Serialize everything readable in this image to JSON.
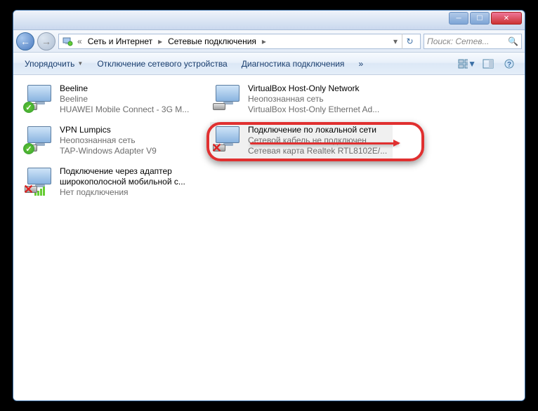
{
  "breadcrumb": {
    "part1": "Сеть и Интернет",
    "part2": "Сетевые подключения"
  },
  "search": {
    "placeholder": "Поиск: Сетев..."
  },
  "toolbar": {
    "organize": "Упорядочить",
    "disable": "Отключение сетевого устройства",
    "diagnose": "Диагностика подключения",
    "more": "»"
  },
  "connections": {
    "left": [
      {
        "name": "Beeline",
        "status": "Beeline",
        "device": "HUAWEI Mobile Connect - 3G M...",
        "badge": "check"
      },
      {
        "name": "VPN Lumpics",
        "status": "Неопознанная сеть",
        "device": "TAP-Windows Adapter V9",
        "badge": "check"
      },
      {
        "name": "Подключение через адаптер широкополосной мобильной с...",
        "status": "Нет подключения",
        "device": "",
        "badge": "bars-x"
      }
    ],
    "right": [
      {
        "name": "VirtualBox Host-Only Network",
        "status": "Неопознанная сеть",
        "device": "VirtualBox Host-Only Ethernet Ad...",
        "badge": "none"
      },
      {
        "name": "Подключение по локальной сети",
        "status": "Сетевой кабель не подключен",
        "device": "Сетевая карта Realtek RTL8102E/...",
        "badge": "x"
      }
    ]
  }
}
